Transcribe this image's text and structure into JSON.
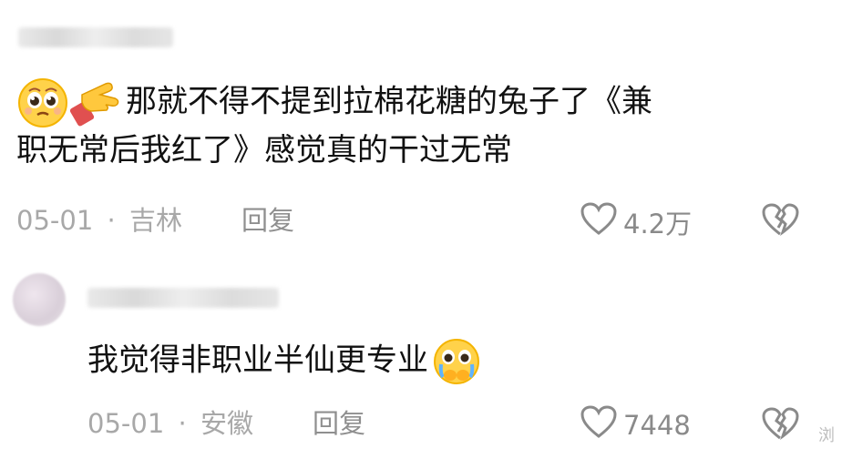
{
  "comments": [
    {
      "body_line1": "那就不得不提到拉棉花糖的兔子了《兼",
      "body_line2": "职无常后我红了》感觉真的干过无常",
      "date": "05-01",
      "location": "吉林",
      "reply_label": "回复",
      "like_count": "4.2万"
    },
    {
      "body_line1": "我觉得非职业半仙更专业",
      "date": "05-01",
      "location": "安徽",
      "reply_label": "回复",
      "like_count": "7448"
    }
  ],
  "separator": "·",
  "edge_text": "浏"
}
